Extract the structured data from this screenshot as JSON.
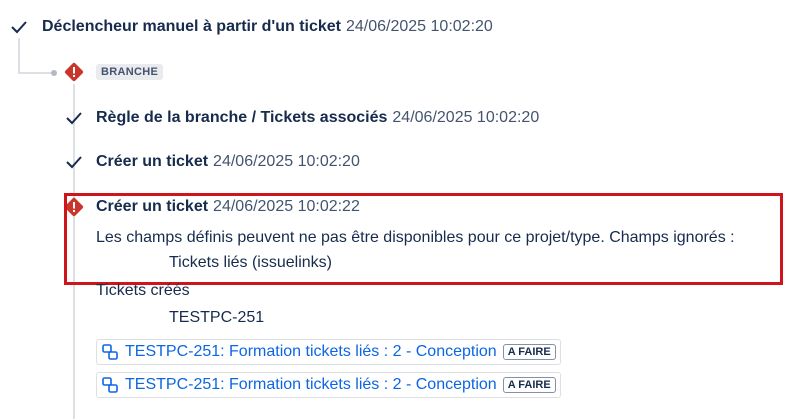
{
  "trigger": {
    "title": "Déclencheur manuel à partir d'un ticket",
    "timestamp": "24/06/2025 10:02:20",
    "status_icon": "check-icon"
  },
  "branch": {
    "label": "BRANCHE",
    "status_icon": "error-icon"
  },
  "steps": [
    {
      "title": "Règle de la branche / Tickets associés",
      "timestamp": "24/06/2025 10:02:20",
      "status_icon": "check-icon"
    },
    {
      "title": "Créer un ticket",
      "timestamp": "24/06/2025 10:02:20",
      "status_icon": "check-icon"
    },
    {
      "title": "Créer un ticket",
      "timestamp": "24/06/2025 10:02:22",
      "status_icon": "error-icon",
      "warning_message": "Les champs définis peuvent ne pas être disponibles pour ce projet/type. Champs ignorés :",
      "ignored_field": "Tickets liés (issuelinks)",
      "created_label": "Tickets créés",
      "created_key": "TESTPC-251"
    }
  ],
  "linked_issues": [
    {
      "text": "TESTPC-251: Formation tickets liés : 2 - Conception",
      "status": "A FAIRE",
      "icon": "subtask-icon"
    },
    {
      "text": "TESTPC-251: Formation tickets liés : 2 - Conception",
      "status": "A FAIRE",
      "icon": "subtask-icon"
    }
  ],
  "colors": {
    "error": "#c9372c",
    "highlight_border": "#d0141c",
    "link": "#0c66e4",
    "connector": "#dcdfe4"
  }
}
